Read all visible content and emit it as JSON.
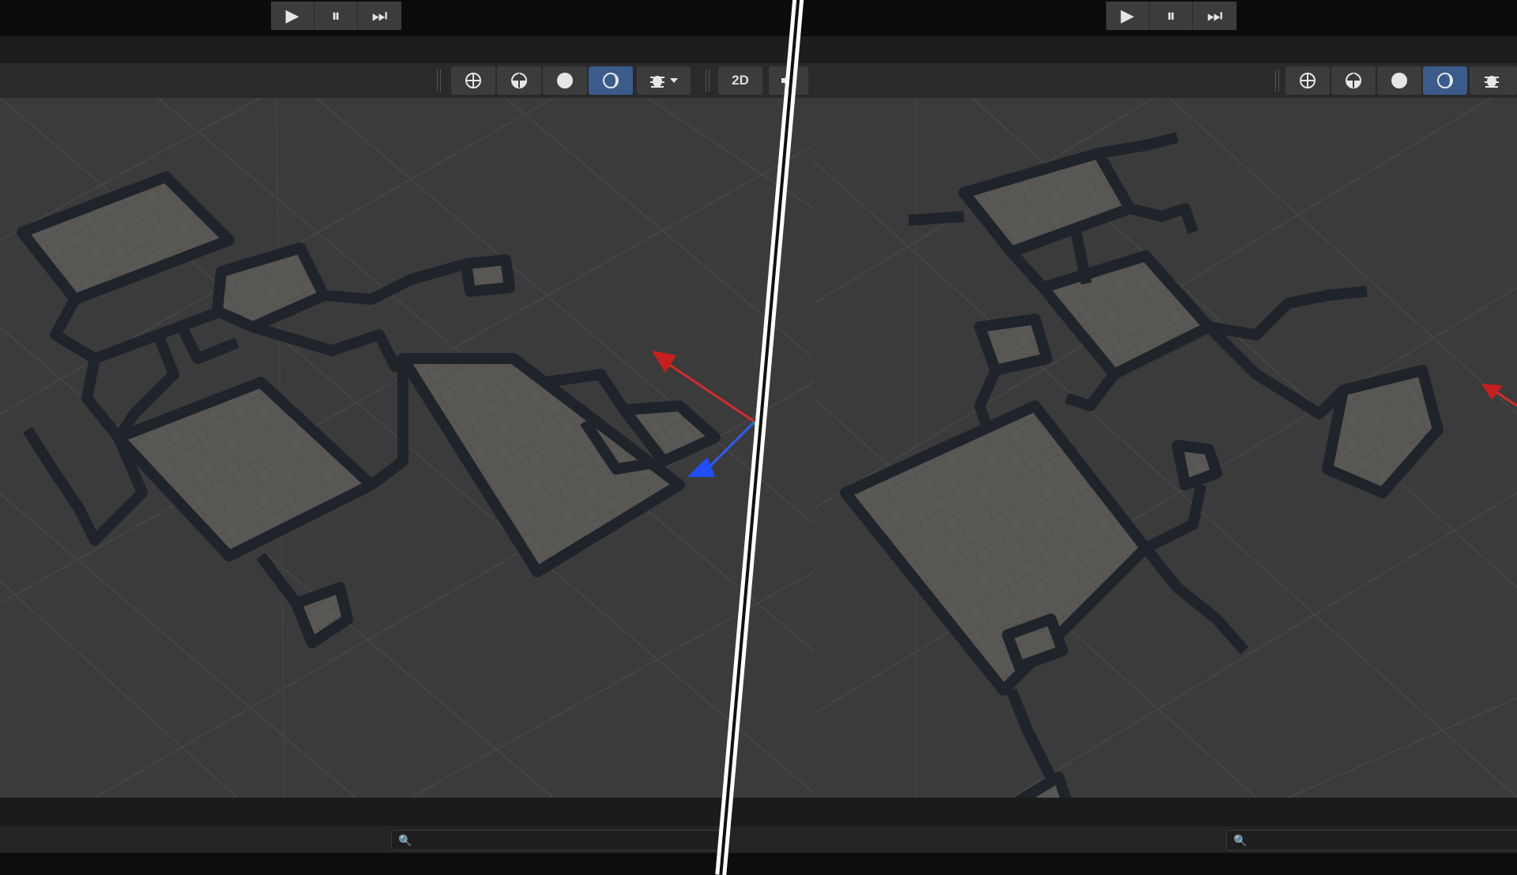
{
  "left_pane": {
    "play_button": "▶",
    "pause_button": "⏸",
    "step_button": "⏭",
    "tools": {
      "wireframe_icon": "wireframe-shading-icon",
      "shaded_wire_icon": "shaded-wireframe-icon",
      "shaded_icon": "shaded-icon",
      "lit_icon": "lit-shading-icon",
      "gizmos_icon": "gizmos-icon",
      "dropdown_icon": "chevron-down-icon",
      "view_2d_label": "2D",
      "audio_icon": "audio-mute-icon"
    },
    "search_placeholder": ""
  },
  "right_pane": {
    "play_button": "▶",
    "pause_button": "⏸",
    "step_button": "⏭",
    "tools": {
      "wireframe_icon": "wireframe-shading-icon",
      "shaded_wire_icon": "shaded-wireframe-icon",
      "shaded_icon": "shaded-icon",
      "lit_icon": "lit-shading-icon",
      "gizmos_icon": "gizmos-icon"
    },
    "search_placeholder": ""
  },
  "colors": {
    "active_tool": "#3a5b8c",
    "viewport_bg": "#3b3b3b",
    "gizmo_x": "#d22b2b",
    "gizmo_z": "#2a5cff",
    "gizmo_y": "#3fbf3f"
  }
}
